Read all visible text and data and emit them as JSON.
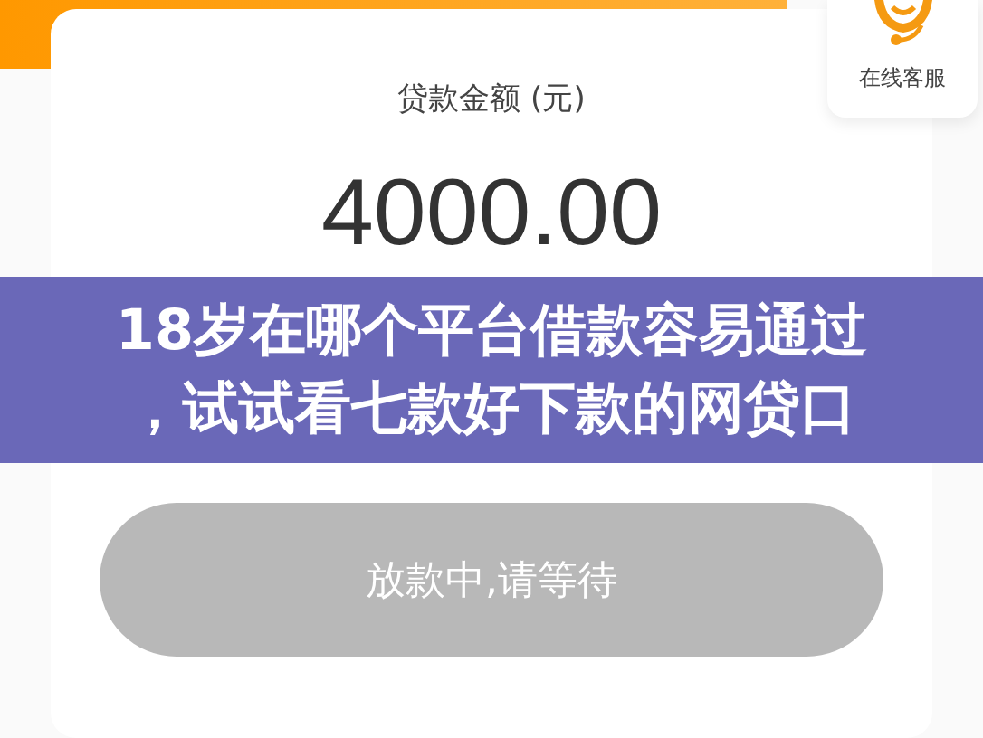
{
  "support": {
    "label": "在线客服"
  },
  "loan": {
    "label": "贷款金额 (元)",
    "amount": "4000.00"
  },
  "button": {
    "label": "放款中,请等待",
    "disabled": true
  },
  "banner": {
    "lines": [
      "18岁在哪个平台借款容易通过",
      "，试试看七款好下款的网贷口"
    ]
  }
}
